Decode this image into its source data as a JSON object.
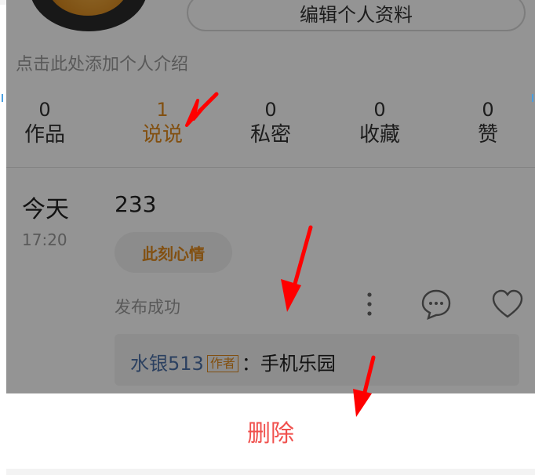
{
  "profile": {
    "edit_button": "编辑个人资料",
    "bio_placeholder": "点击此处添加个人介绍"
  },
  "stats": [
    {
      "count": "0",
      "label": "作品"
    },
    {
      "count": "1",
      "label": "说说"
    },
    {
      "count": "0",
      "label": "私密"
    },
    {
      "count": "0",
      "label": "收藏"
    },
    {
      "count": "0",
      "label": "赞"
    }
  ],
  "post": {
    "day": "今天",
    "time": "17:20",
    "text": "233",
    "mood_tag": "此刻心情",
    "status": "发布成功",
    "comment": {
      "user": "水银513",
      "author_tag": "作者",
      "text": "：手机乐园"
    }
  },
  "sheet": {
    "delete_label": "删除"
  },
  "colors": {
    "accent": "#e08a1e",
    "delete": "#f0504d",
    "arrow": "#ff0000",
    "link": "#4a6fa5"
  }
}
